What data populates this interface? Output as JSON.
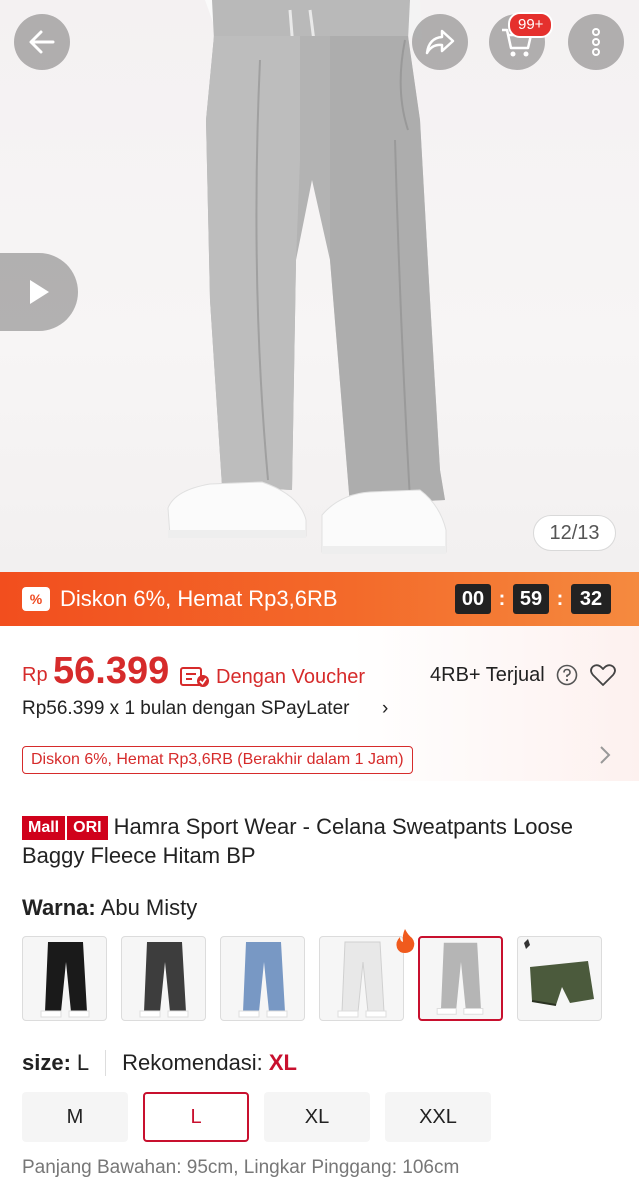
{
  "gallery": {
    "counter": "12/13"
  },
  "header": {
    "cart_badge": "99+"
  },
  "flash_sale": {
    "icon_text": "%",
    "text": "Diskon 6%, Hemat Rp3,6RB",
    "timer": {
      "hours": "00",
      "minutes": "59",
      "seconds": "32"
    }
  },
  "price": {
    "currency": "Rp",
    "value": "56.399",
    "voucher_label": "Dengan Voucher",
    "sold": "4RB+ Terjual",
    "paylater": "Rp56.399 x 1 bulan dengan SPayLater",
    "paylater_chevron": "›",
    "promo_tag": "Diskon 6%, Hemat Rp3,6RB (Berakhir dalam 1 Jam)"
  },
  "product": {
    "badge_mall": "Mall",
    "badge_ori": "ORI",
    "title": "Hamra Sport Wear -  Celana Sweatpants Loose Baggy Fleece Hitam BP"
  },
  "variation": {
    "label": "Warna:",
    "value": "Abu Misty",
    "swatches": [
      "Hitam",
      "Abu Tua",
      "Biru",
      "Putih",
      "Abu Misty",
      "Army"
    ],
    "selected_index": 4
  },
  "size": {
    "label": "size:",
    "value": "L",
    "recommendation_label": "Rekomendasi:",
    "recommendation_value": "XL",
    "options": [
      "M",
      "L",
      "XL",
      "XXL"
    ],
    "selected_index": 1,
    "measurement": "Panjang Bawahan: 95cm, Lingkar Pinggang: 106cm"
  },
  "colors": {
    "accent": "#d62b2b",
    "flash_start": "#f24e1e",
    "flash_end": "#f58a3f"
  }
}
